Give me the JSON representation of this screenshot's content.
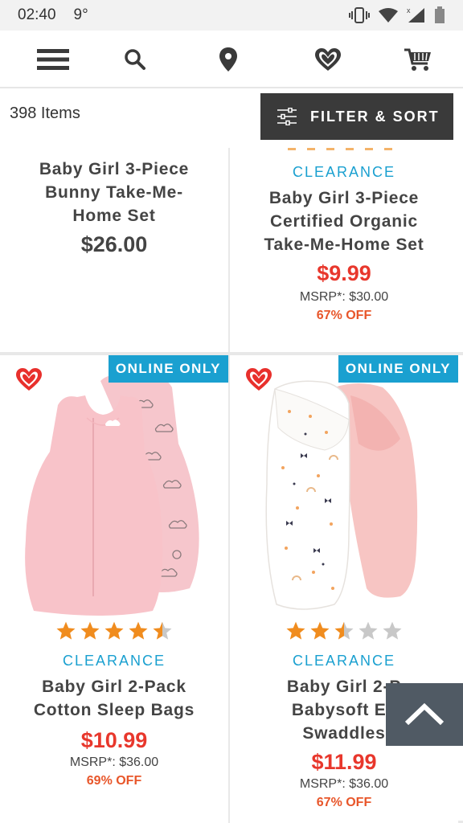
{
  "status_bar": {
    "time": "02:40",
    "temp": "9°"
  },
  "nav": {
    "icons": [
      "menu-icon",
      "search-icon",
      "location-pin-icon",
      "heart-icon",
      "cart-icon"
    ]
  },
  "results": {
    "count": "398 Items",
    "filter_label": "FILTER & SORT"
  },
  "products": [
    {
      "name": [
        "Baby Girl 3-Piece",
        "Bunny Take-Me-",
        "Home Set"
      ],
      "price": "$26.00"
    },
    {
      "tag": "CLEARANCE",
      "name": [
        "Baby Girl 3-Piece",
        "Certified Organic",
        "Take-Me-Home Set"
      ],
      "price": "$9.99",
      "msrp": "MSRP*: $30.00",
      "off": "67% OFF"
    },
    {
      "badge": "ONLINE ONLY",
      "image": "pink-sleep-bags-image",
      "rating": 4.5,
      "tag": "CLEARANCE",
      "name": [
        "Baby Girl 2-Pack",
        "Cotton Sleep Bags"
      ],
      "price": "$10.99",
      "msrp": "MSRP*: $36.00",
      "off": "69% OFF"
    },
    {
      "badge": "ONLINE ONLY",
      "image": "swaddles-image",
      "rating": 2.5,
      "tag": "CLEARANCE",
      "name": [
        "Baby Girl 2-P",
        "Babysoft Ea",
        "Swaddles"
      ],
      "price": "$11.99",
      "msrp": "MSRP*: $36.00",
      "off": "67% OFF"
    }
  ],
  "colors": {
    "accent": "#1aa0d0",
    "sale": "#e8372c",
    "off": "#e8562a",
    "star": "#f08c1e",
    "heart": "#e8302c"
  }
}
